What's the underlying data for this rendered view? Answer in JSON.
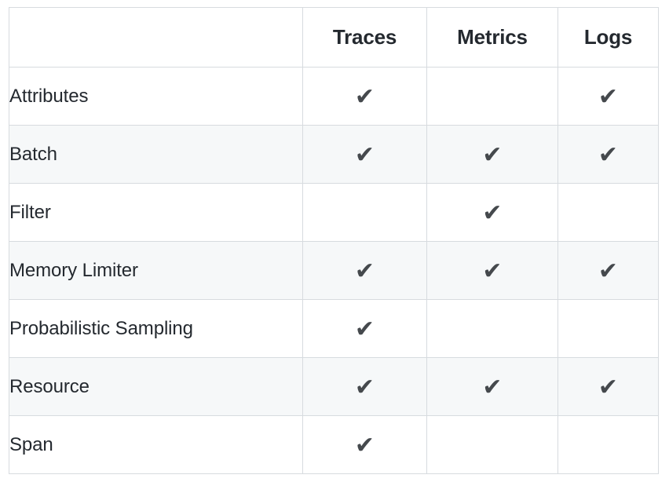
{
  "table": {
    "columns": [
      {
        "key": "name",
        "label": ""
      },
      {
        "key": "traces",
        "label": "Traces"
      },
      {
        "key": "metrics",
        "label": "Metrics"
      },
      {
        "key": "logs",
        "label": "Logs"
      }
    ],
    "check_glyph": "✔",
    "rows": [
      {
        "name": "Attributes",
        "traces": true,
        "metrics": false,
        "logs": true
      },
      {
        "name": "Batch",
        "traces": true,
        "metrics": true,
        "logs": true
      },
      {
        "name": "Filter",
        "traces": false,
        "metrics": true,
        "logs": false
      },
      {
        "name": "Memory Limiter",
        "traces": true,
        "metrics": true,
        "logs": true
      },
      {
        "name": "Probabilistic Sampling",
        "traces": true,
        "metrics": false,
        "logs": false
      },
      {
        "name": "Resource",
        "traces": true,
        "metrics": true,
        "logs": true
      },
      {
        "name": "Span",
        "traces": true,
        "metrics": false,
        "logs": false
      }
    ]
  },
  "colors": {
    "border": "#d7dbdf",
    "stripe": "#f6f8f9",
    "text": "#24292f",
    "check": "#45494d",
    "background": "#ffffff"
  }
}
